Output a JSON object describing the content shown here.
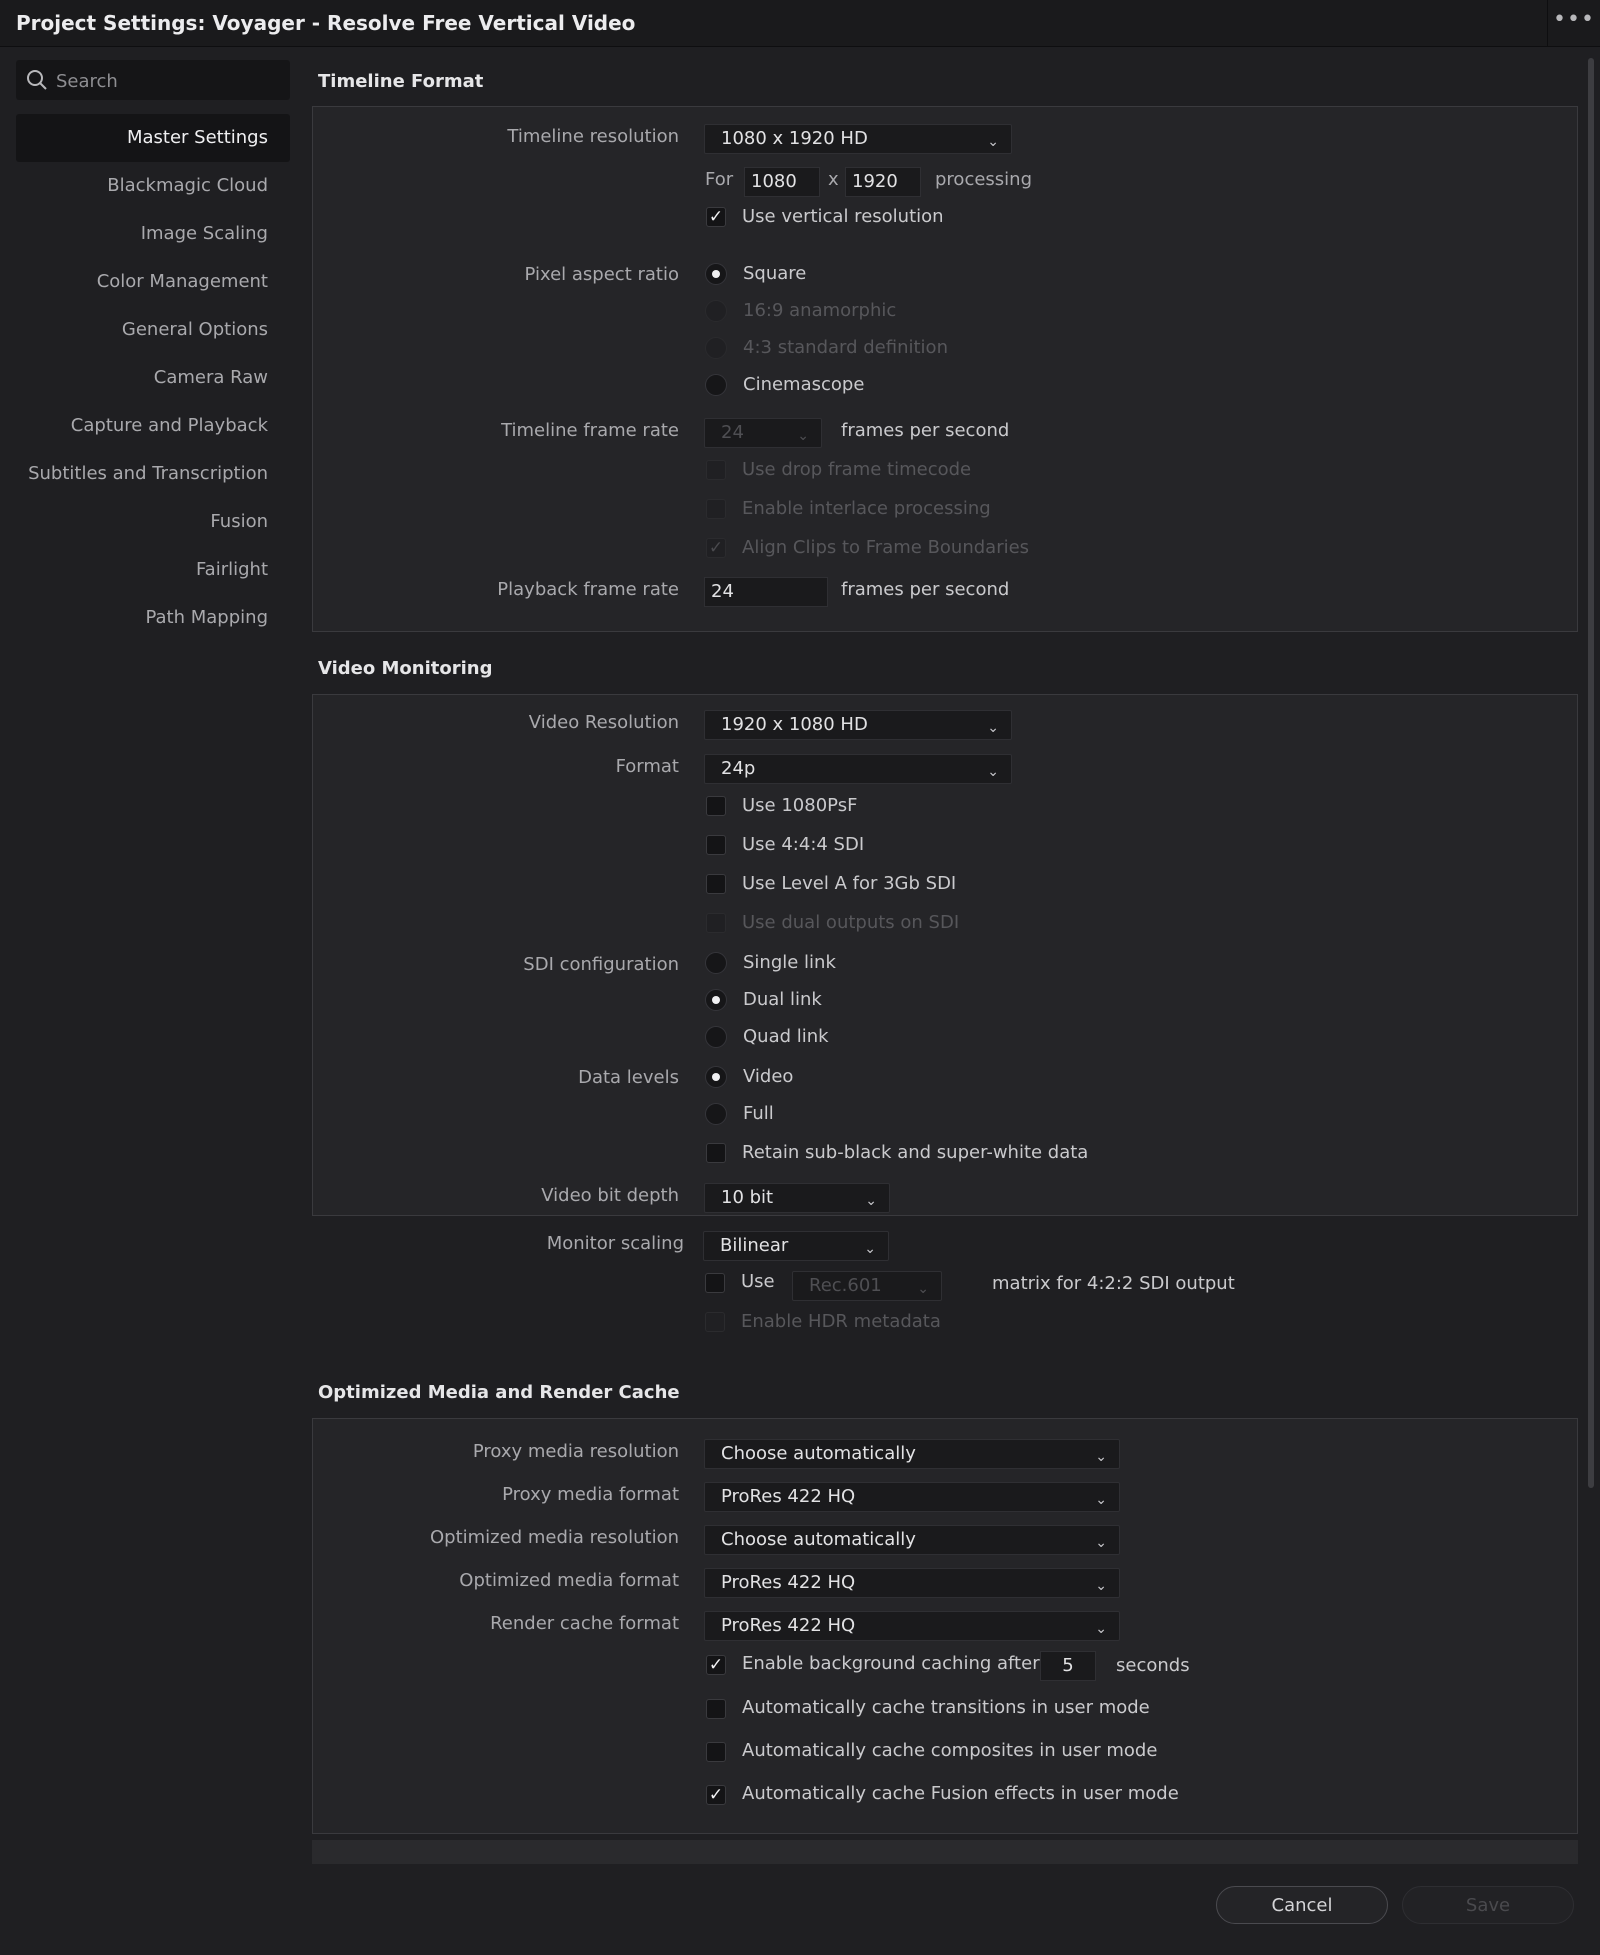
{
  "window": {
    "title": "Project Settings: Voyager - Resolve Free Vertical Video",
    "more_label": "•••"
  },
  "search": {
    "placeholder": "Search",
    "icon": "search-icon"
  },
  "sidebar": {
    "items": [
      {
        "label": "Master Settings",
        "active": true
      },
      {
        "label": "Blackmagic Cloud"
      },
      {
        "label": "Image Scaling"
      },
      {
        "label": "Color Management"
      },
      {
        "label": "General Options"
      },
      {
        "label": "Camera Raw"
      },
      {
        "label": "Capture and Playback"
      },
      {
        "label": "Subtitles and Transcription"
      },
      {
        "label": "Fusion"
      },
      {
        "label": "Fairlight"
      },
      {
        "label": "Path Mapping"
      }
    ]
  },
  "timeline_format": {
    "title": "Timeline Format",
    "timeline_resolution": {
      "label": "Timeline resolution",
      "value": "1080 x 1920 HD"
    },
    "processing": {
      "for_label": "For",
      "width": "1080",
      "x_label": "x",
      "height": "1920",
      "suffix": "processing"
    },
    "use_vertical": {
      "label": "Use vertical resolution",
      "checked": true
    },
    "pixel_aspect": {
      "label": "Pixel aspect ratio",
      "options": [
        {
          "label": "Square",
          "selected": true,
          "enabled": true
        },
        {
          "label": "16:9 anamorphic",
          "selected": false,
          "enabled": false
        },
        {
          "label": "4:3 standard definition",
          "selected": false,
          "enabled": false
        },
        {
          "label": "Cinemascope",
          "selected": false,
          "enabled": true
        }
      ]
    },
    "frame_rate": {
      "label": "Timeline frame rate",
      "value": "24",
      "suffix": "frames per second"
    },
    "drop_frame": {
      "label": "Use drop frame timecode",
      "checked": false
    },
    "interlace": {
      "label": "Enable interlace processing",
      "checked": false
    },
    "align_clips": {
      "label": "Align Clips to Frame Boundaries",
      "checked": true
    },
    "playback_rate": {
      "label": "Playback frame rate",
      "value": "24",
      "suffix": "frames per second"
    }
  },
  "video_monitoring": {
    "title": "Video Monitoring",
    "video_resolution": {
      "label": "Video Resolution",
      "value": "1920 x 1080 HD"
    },
    "format": {
      "label": "Format",
      "value": "24p"
    },
    "checks": [
      {
        "label": "Use 1080PsF",
        "checked": false,
        "enabled": true
      },
      {
        "label": "Use 4:4:4 SDI",
        "checked": false,
        "enabled": true
      },
      {
        "label": "Use Level A for 3Gb SDI",
        "checked": false,
        "enabled": true
      },
      {
        "label": "Use dual outputs on SDI",
        "checked": false,
        "enabled": false
      }
    ],
    "sdi_config": {
      "label": "SDI configuration",
      "options": [
        {
          "label": "Single link",
          "selected": false
        },
        {
          "label": "Dual link",
          "selected": true
        },
        {
          "label": "Quad link",
          "selected": false
        }
      ]
    },
    "data_levels": {
      "label": "Data levels",
      "options": [
        {
          "label": "Video",
          "selected": true
        },
        {
          "label": "Full",
          "selected": false
        }
      ]
    },
    "retain": {
      "label": "Retain sub-black and super-white data",
      "checked": false
    },
    "bit_depth": {
      "label": "Video bit depth",
      "value": "10 bit"
    },
    "monitor_scaling": {
      "label": "Monitor scaling",
      "value": "Bilinear"
    },
    "matrix": {
      "use_label": "Use",
      "value": "Rec.601",
      "suffix": "matrix for 4:2:2 SDI output",
      "checked": false
    },
    "hdr": {
      "label": "Enable HDR metadata",
      "checked": false
    }
  },
  "cache": {
    "title": "Optimized Media and Render Cache",
    "proxy_resolution": {
      "label": "Proxy media resolution",
      "value": "Choose automatically"
    },
    "proxy_format": {
      "label": "Proxy media format",
      "value": "ProRes 422 HQ"
    },
    "optimized_resolution": {
      "label": "Optimized media resolution",
      "value": "Choose automatically"
    },
    "optimized_format": {
      "label": "Optimized media format",
      "value": "ProRes 422 HQ"
    },
    "render_format": {
      "label": "Render cache format",
      "value": "ProRes 422 HQ"
    },
    "background": {
      "label": "Enable background caching after",
      "value": "5",
      "suffix": "seconds",
      "checked": true
    },
    "auto_transitions": {
      "label": "Automatically cache transitions in user mode",
      "checked": false
    },
    "auto_composites": {
      "label": "Automatically cache composites in user mode",
      "checked": false
    },
    "auto_fusion": {
      "label": "Automatically cache Fusion effects in user mode",
      "checked": true
    }
  },
  "buttons": {
    "cancel": "Cancel",
    "save": "Save"
  },
  "glyphs": {
    "check": "✓",
    "chevron": "⌄"
  }
}
